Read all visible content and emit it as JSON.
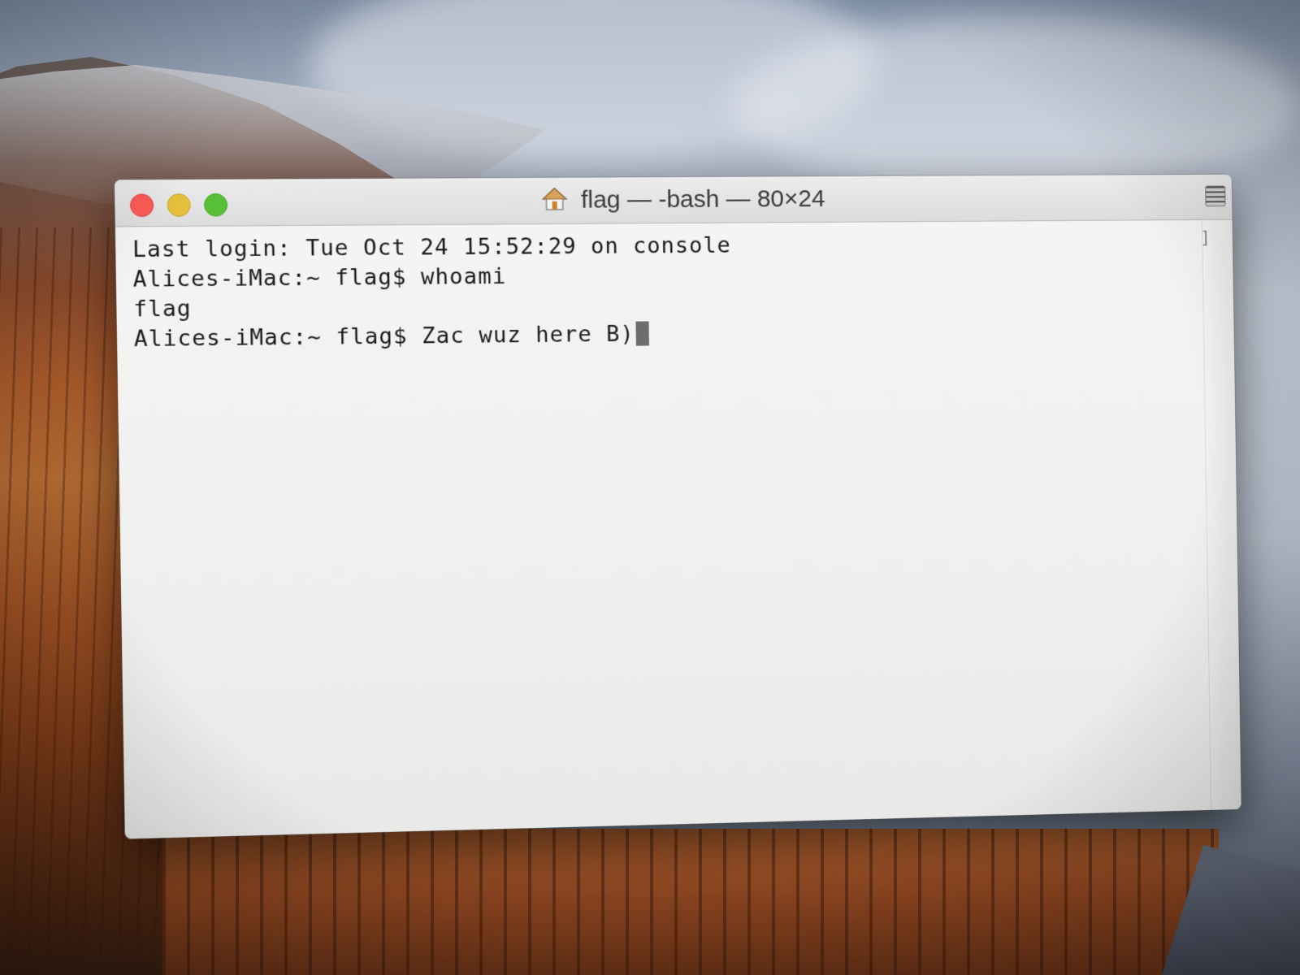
{
  "window": {
    "title": "flag — -bash — 80×24",
    "title_icon": "home-icon"
  },
  "terminal": {
    "lines": [
      "Last login: Tue Oct 24 15:52:29 on console",
      "Alices-iMac:~ flag$ whoami",
      "flag",
      "Alices-iMac:~ flag$ Zac wuz here B)"
    ],
    "scroll_marker": "]"
  },
  "colors": {
    "close": "#fc5b57",
    "minimize": "#e5bf3c",
    "zoom": "#57c038",
    "terminal_background": "#f1f1f0",
    "text": "#1b1b1b"
  }
}
